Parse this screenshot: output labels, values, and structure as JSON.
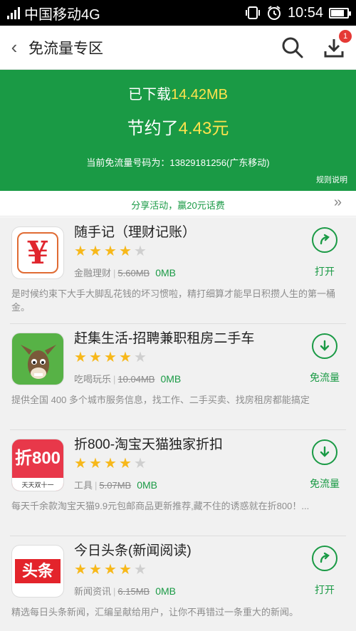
{
  "status_bar": {
    "carrier": "中国移动4G",
    "time": "10:54",
    "battery_level": 0.8
  },
  "header": {
    "title": "免流量专区",
    "download_badge": "1"
  },
  "banner": {
    "downloaded_prefix": "已下载",
    "downloaded_value": "14.42MB",
    "saved_prefix": "节约了",
    "saved_value": "4.43元",
    "number_text": "当前免流量号码为：13829181256(广东移动)",
    "rules_label": "规则说明"
  },
  "share": {
    "text": "分享活动，赢20元话费"
  },
  "apps": [
    {
      "name": "随手记（理财记账）",
      "rating": 4,
      "category": "金融理财",
      "size": "5.60MB",
      "traffic": "0MB",
      "action": "打开",
      "description": "是时候约束下大手大脚乱花钱的坏习惯啦，精打细算才能早日积攒人生的第一桶金。",
      "icon_text": "¥"
    },
    {
      "name": "赶集生活-招聘兼职租房二手车",
      "rating": 4,
      "category": "吃喝玩乐",
      "size": "10.04MB",
      "traffic": "0MB",
      "action": "免流量",
      "description": "提供全国 400 多个城市服务信息，找工作、二手买卖、找房租房都能搞定"
    },
    {
      "name": "折800-淘宝天猫独家折扣",
      "rating": 4,
      "category": "工具",
      "size": "5.07MB",
      "traffic": "0MB",
      "action": "免流量",
      "description": "每天千余款淘宝天猫9.9元包邮商品更新推荐,藏不住的诱惑就在折800！...",
      "icon_text": "折800",
      "icon_subtext": "天天双十一"
    },
    {
      "name": "今日头条(新闻阅读)",
      "rating": 4,
      "category": "新闻资讯",
      "size": "6.15MB",
      "traffic": "0MB",
      "action": "打开",
      "description": "精选每日头条新闻，汇编呈献给用户，让你不再错过一条重大的新闻。",
      "icon_text": "头条"
    }
  ],
  "colors": {
    "brand_green": "#1a9a45",
    "highlight_yellow": "#ffe34d",
    "star_gold": "#f7b81a"
  },
  "icons": [
    "signal-icon",
    "vibrate-icon",
    "alarm-icon",
    "battery-icon",
    "back-icon",
    "search-icon",
    "download-icon",
    "double-chevron-right-icon",
    "open-arrow-icon",
    "download-arrow-icon",
    "star-icon"
  ]
}
